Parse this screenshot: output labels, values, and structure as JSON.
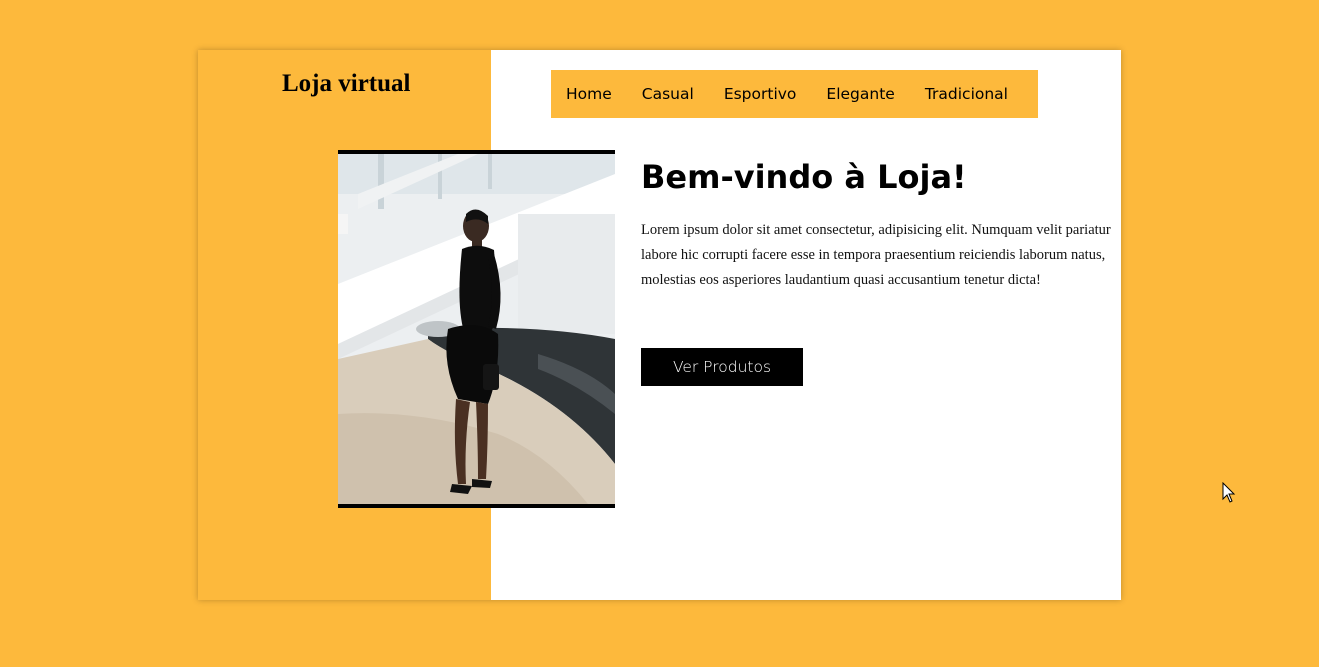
{
  "brand": {
    "name": "Loja virtual"
  },
  "nav": {
    "items": [
      {
        "label": "Home"
      },
      {
        "label": "Casual"
      },
      {
        "label": "Esportivo"
      },
      {
        "label": "Elegante"
      },
      {
        "label": "Tradicional"
      }
    ]
  },
  "hero": {
    "title": "Bem-vindo à Loja!",
    "description": "Lorem ipsum dolor sit amet consectetur, adipisicing elit. Numquam velit pariatur labore hic corrupti facere esse in tempora praesentium reiciendis laborum natus, molestias eos asperiores laudantium quasi accusantium tenetur dicta!",
    "button_label": "Ver Produtos"
  },
  "colors": {
    "accent": "#fdb93c",
    "button_bg": "#000000",
    "button_text": "#ffffff"
  },
  "icons": {
    "cursor": "mouse-pointer-icon"
  }
}
